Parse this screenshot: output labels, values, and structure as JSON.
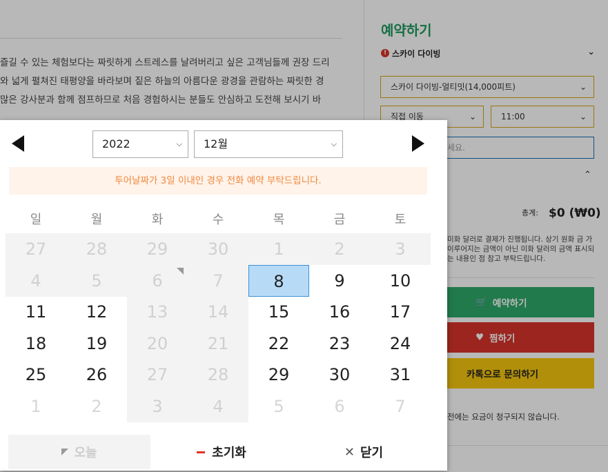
{
  "background": {
    "paragraph": [
      "즐길 수 있는 체험보다는 짜릿하게 스트레스를 날려버리고 싶은 고객님들께 권장 드리",
      "와 넓게 펼쳐진 태평양을 바라보며 짙은 하늘의 아름다운 광경을 관람하는 짜릿한 경",
      "많은 강사분과 함께 점프하므로 처음 경험하시는 분들도 안심하고 도전해 보시기 바"
    ]
  },
  "booking": {
    "title": "예약하기",
    "alert_label": "스카이 다이빙",
    "product": "스카이 다이빙-얼티밋(14,000피트)",
    "move_option": "직접 이동",
    "time": "11:00",
    "message_placeholder": "세요.",
    "total_label": "총계:",
    "total_value": "$0 (₩0)",
    "note": "미화 달러로 결제가 진행됩니다. 상기 원화 금 가 이루어지는 금액이 아닌 미화 달러의 금액 표시되는 내용인 점 참고 부탁드립니다.",
    "book_button": "예약하기",
    "wish_button": "찜하기",
    "kakao_button": "카톡으로 문의하기",
    "footer_note": "전에는 요금이 청구되지 않습니다."
  },
  "calendar": {
    "year": "2022",
    "month": "12월",
    "notice": "투어날짜가 3일 이내인 경우 전화 예약 부탁드립니다.",
    "weekdays": [
      "일",
      "월",
      "화",
      "수",
      "목",
      "금",
      "토"
    ],
    "weeks": [
      [
        {
          "d": "27",
          "s": "dis"
        },
        {
          "d": "28",
          "s": "dis"
        },
        {
          "d": "29",
          "s": "dis"
        },
        {
          "d": "30",
          "s": "dis"
        },
        {
          "d": "1",
          "s": "dis"
        },
        {
          "d": "2",
          "s": "dis"
        },
        {
          "d": "3",
          "s": "dis"
        }
      ],
      [
        {
          "d": "4",
          "s": "dis"
        },
        {
          "d": "5",
          "s": "dis"
        },
        {
          "d": "6",
          "s": "dis",
          "mark": true
        },
        {
          "d": "7",
          "s": "dis"
        },
        {
          "d": "8",
          "s": "sel"
        },
        {
          "d": "9",
          "s": "on"
        },
        {
          "d": "10",
          "s": "on"
        }
      ],
      [
        {
          "d": "11",
          "s": "on"
        },
        {
          "d": "12",
          "s": "on"
        },
        {
          "d": "13",
          "s": "dis"
        },
        {
          "d": "14",
          "s": "dis"
        },
        {
          "d": "15",
          "s": "on"
        },
        {
          "d": "16",
          "s": "on"
        },
        {
          "d": "17",
          "s": "on"
        }
      ],
      [
        {
          "d": "18",
          "s": "on"
        },
        {
          "d": "19",
          "s": "on"
        },
        {
          "d": "20",
          "s": "dis"
        },
        {
          "d": "21",
          "s": "dis"
        },
        {
          "d": "22",
          "s": "on"
        },
        {
          "d": "23",
          "s": "on"
        },
        {
          "d": "24",
          "s": "on"
        }
      ],
      [
        {
          "d": "25",
          "s": "on"
        },
        {
          "d": "26",
          "s": "on"
        },
        {
          "d": "27",
          "s": "dis"
        },
        {
          "d": "28",
          "s": "dis"
        },
        {
          "d": "29",
          "s": "on"
        },
        {
          "d": "30",
          "s": "on"
        },
        {
          "d": "31",
          "s": "on"
        }
      ],
      [
        {
          "d": "1",
          "s": "faded"
        },
        {
          "d": "2",
          "s": "faded"
        },
        {
          "d": "3",
          "s": "dis"
        },
        {
          "d": "4",
          "s": "dis"
        },
        {
          "d": "5",
          "s": "faded"
        },
        {
          "d": "6",
          "s": "faded"
        },
        {
          "d": "7",
          "s": "faded"
        }
      ]
    ],
    "today_label": "오늘",
    "reset_label": "초기화",
    "close_label": "닫기"
  },
  "colors": {
    "accent_green": "#1f9a5c",
    "selected_day": "#b7dbf7",
    "notice_text": "#f0893f",
    "reset_dash": "#e53225"
  }
}
